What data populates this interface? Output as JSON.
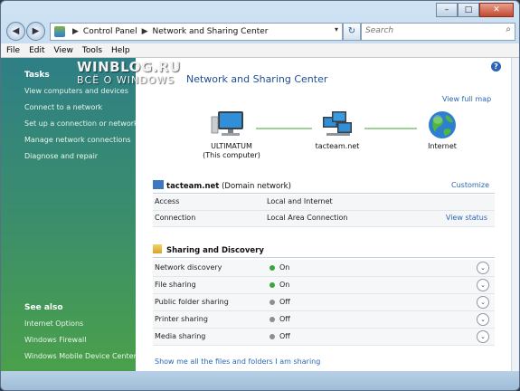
{
  "window": {
    "minimize": "–",
    "maximize": "□",
    "close": "✕"
  },
  "nav": {
    "back": "◀",
    "forward": "▶"
  },
  "address": {
    "crumbs": [
      "Control Panel",
      "Network and Sharing Center"
    ],
    "separator": "▶",
    "dropdown": "▾"
  },
  "refresh_glyph": "↻",
  "search": {
    "placeholder": "Search",
    "icon_glyph": "⌕"
  },
  "menu": [
    "File",
    "Edit",
    "View",
    "Tools",
    "Help"
  ],
  "sidebar": {
    "tasks_header": "Tasks",
    "tasks": [
      "View computers and devices",
      "Connect to a network",
      "Set up a connection or network",
      "Manage network connections",
      "Diagnose and repair"
    ],
    "see_also_header": "See also",
    "see_also": [
      "Internet Options",
      "Windows Firewall",
      "Windows Mobile Device Center"
    ]
  },
  "watermark": {
    "line1": "WINBLOG.RU",
    "line2": "ВСЁ О WINDOWS"
  },
  "content": {
    "help": "?",
    "title": "Network and Sharing Center",
    "view_full_map": "View full map",
    "map": {
      "computer": {
        "name": "ULTIMATUM",
        "sub": "(This computer)"
      },
      "network": {
        "name": "tacteam.net"
      },
      "internet": {
        "name": "Internet"
      }
    },
    "network": {
      "name": "tacteam.net",
      "type": "(Domain network)",
      "customize": "Customize",
      "rows": [
        {
          "key": "Access",
          "value": "Local and Internet",
          "action": ""
        },
        {
          "key": "Connection",
          "value": "Local Area Connection",
          "action": "View status"
        }
      ]
    },
    "sharing": {
      "header": "Sharing and Discovery",
      "rows": [
        {
          "key": "Network discovery",
          "value": "On"
        },
        {
          "key": "File sharing",
          "value": "On"
        },
        {
          "key": "Public folder sharing",
          "value": "Off"
        },
        {
          "key": "Printer sharing",
          "value": "Off"
        },
        {
          "key": "Media sharing",
          "value": "Off"
        }
      ],
      "chevron": "⌄"
    },
    "show_all": "Show me all the files and folders I am sharing"
  },
  "colors": {
    "on_dot": "#3aa53a",
    "off_dot": "#8a8f96",
    "link": "#2a67b4",
    "sidebar_top": "#2e7f86",
    "sidebar_bottom": "#4aa04a"
  }
}
